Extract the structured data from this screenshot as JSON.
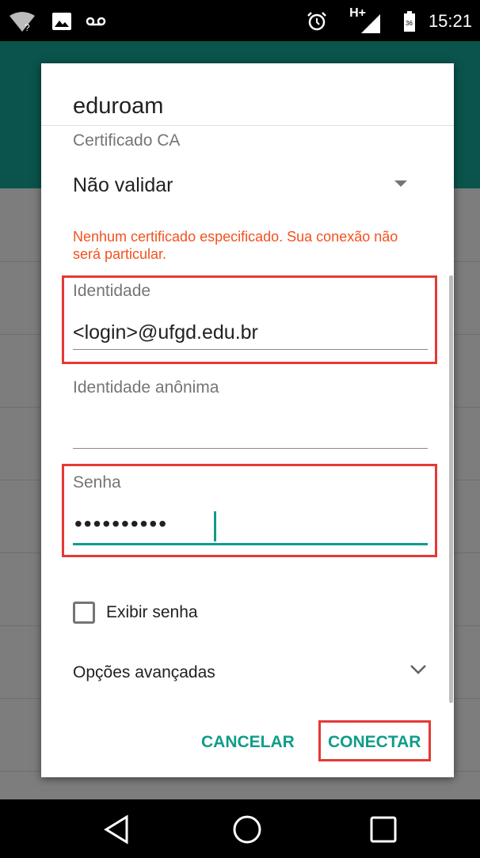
{
  "status_bar": {
    "time": "15:21",
    "network": "H+",
    "battery_level": "36"
  },
  "dialog": {
    "title": "eduroam",
    "ca_cert": {
      "label": "Certificado CA",
      "value": "Não validar"
    },
    "warning": "Nenhum certificado especificado. Sua conexão não será particular.",
    "identity": {
      "label": "Identidade",
      "value": "<login>@ufgd.edu.br"
    },
    "anon_identity": {
      "label": "Identidade anônima",
      "value": ""
    },
    "password": {
      "label": "Senha",
      "value": "••••••••••"
    },
    "show_password": {
      "label": "Exibir senha",
      "checked": false
    },
    "advanced": {
      "label": "Opções avançadas"
    },
    "buttons": {
      "cancel": "CANCELAR",
      "connect": "CONECTAR"
    }
  },
  "colors": {
    "accent": "#0f9d8a",
    "warning": "#f4511e",
    "highlight": "#e53935"
  }
}
